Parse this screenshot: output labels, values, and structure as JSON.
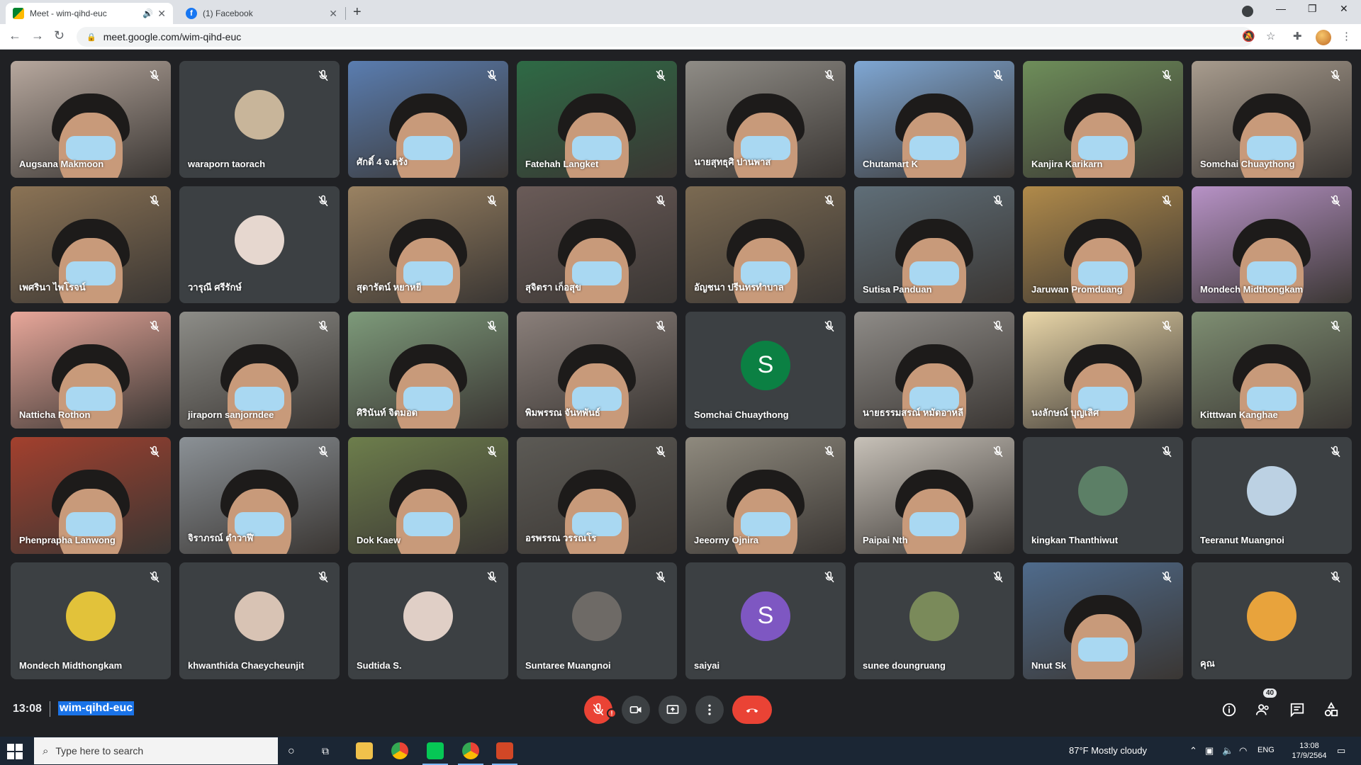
{
  "browser": {
    "tabs": [
      {
        "title": "Meet - wim-qihd-euc",
        "active": true
      },
      {
        "title": "(1) Facebook",
        "active": false
      }
    ],
    "url": "meet.google.com/wim-qihd-euc"
  },
  "meet": {
    "participants": [
      {
        "name": "Augsana Makmoon",
        "tone": "#b7a89e"
      },
      {
        "name": "waraporn taorach",
        "avatar": true,
        "avatar_color": "#c8b59a"
      },
      {
        "name": "ศักดิ์ 4 จ.ตรัง",
        "tone": "#5a7db0"
      },
      {
        "name": "Fatehah Langket",
        "tone": "#2e6a45"
      },
      {
        "name": "นายสุทธุศิ ปานพาส",
        "tone": "#8f8c86"
      },
      {
        "name": "Chutamart K",
        "tone": "#7fa7d4"
      },
      {
        "name": "Kanjira Karikarn",
        "tone": "#6e8e5a"
      },
      {
        "name": "Somchai Chuaythong",
        "tone": "#a89c8e"
      },
      {
        "name": "เพศรินา ไพโรจน์",
        "tone": "#8b7355"
      },
      {
        "name": "วารุณี ศรีรักษ์",
        "avatar": true,
        "avatar_color": "#e6d7cf"
      },
      {
        "name": "สุดารัตน์ หยาหยี",
        "tone": "#9a8262"
      },
      {
        "name": "สุจิตรา เก็อสุข",
        "tone": "#6a5b58"
      },
      {
        "name": "อัญชนา ปรีนทรทำบาล",
        "tone": "#7b6a52"
      },
      {
        "name": "Sutisa Panduan",
        "tone": "#5f6e78"
      },
      {
        "name": "Jaruwan Promduang",
        "tone": "#b08a4a"
      },
      {
        "name": "Mondech Midthongkam",
        "tone": "#b792c6"
      },
      {
        "name": "Natticha Rothon",
        "tone": "#e8a79a"
      },
      {
        "name": "jiraporn sanjorndee",
        "tone": "#8d8d88"
      },
      {
        "name": "ศิรินันท์ จิตมอด",
        "tone": "#7d9a7a"
      },
      {
        "name": "พิมพรรณ จันทพันธ์",
        "tone": "#8a7f7a"
      },
      {
        "name": "Somchai Chuaythong",
        "avatar": true,
        "letter": "S",
        "avatar_color": "#0b8043"
      },
      {
        "name": "นายธรรมสรณ์ หมัดอาหลี",
        "tone": "#8e8b87"
      },
      {
        "name": "นงลักษณ์ บุญเลิศ",
        "tone": "#e9d6a8"
      },
      {
        "name": "Kitttwan Kanghae",
        "tone": "#7e8e72"
      },
      {
        "name": "Phenprapha Lanwong",
        "tone": "#a3402e"
      },
      {
        "name": "จิราภรณ์ ดำวาฬี",
        "tone": "#8b9196"
      },
      {
        "name": "Dok Kaew",
        "tone": "#6d7e4c"
      },
      {
        "name": "อรพรรณ วรรณโร",
        "tone": "#5c5a55"
      },
      {
        "name": "Jeeorny Ojnira",
        "tone": "#8f8a7e"
      },
      {
        "name": "Paipai Nth",
        "tone": "#c7c1b8"
      },
      {
        "name": "kingkan Thanthiwut",
        "avatar": true,
        "avatar_color": "#5c7f66"
      },
      {
        "name": "Teeranut Muangnoi",
        "avatar": true,
        "avatar_color": "#bcd1e3"
      },
      {
        "name": "Mondech Midthongkam",
        "avatar": true,
        "avatar_color": "#e2c23a"
      },
      {
        "name": "khwanthida Chaeycheunjit",
        "avatar": true,
        "avatar_color": "#d8c3b4"
      },
      {
        "name": "Sudtida S.",
        "avatar": true,
        "avatar_color": "#e0cfc6"
      },
      {
        "name": "Suntaree Muangnoi",
        "avatar": true,
        "avatar_color": "#6e6a66"
      },
      {
        "name": "saiyai",
        "avatar": true,
        "letter": "S",
        "avatar_color": "#7e57c2"
      },
      {
        "name": "sunee doungruang",
        "avatar": true,
        "avatar_color": "#7a8a5a"
      },
      {
        "name": "Nnut Sk",
        "tone": "#4f6b8c"
      },
      {
        "name": "คุณ",
        "avatar": true,
        "avatar_color": "#e8a33c"
      }
    ],
    "time": "13:08",
    "meeting_code": "wim-qihd-euc",
    "participant_count": "40",
    "mic_alert": "!"
  },
  "taskbar": {
    "search_placeholder": "Type here to search",
    "weather": "87°F  Mostly cloudy",
    "lang": "ENG",
    "time": "13:08",
    "date": "17/9/2564"
  }
}
